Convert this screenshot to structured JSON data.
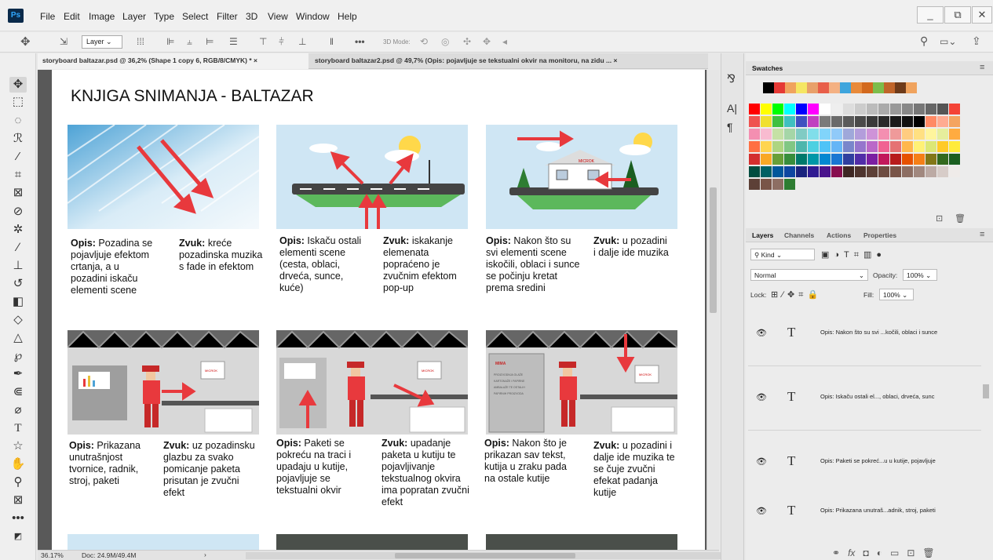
{
  "app": {
    "logo": "Ps",
    "menu": [
      "File",
      "Edit",
      "Image",
      "Layer",
      "Type",
      "Select",
      "Filter",
      "3D",
      "View",
      "Window",
      "Help"
    ]
  },
  "window_controls": {
    "minimize": "_",
    "restore": "⧉",
    "close": "✕"
  },
  "options_bar": {
    "layer_dropdown": "Layer",
    "mode_3d": "3D Mode:",
    "more": "•••"
  },
  "tabs": [
    {
      "label": "storyboard baltazar.psd @ 36,2% (Shape 1 copy 6, RGB/8/CMYK) *",
      "close": "×"
    },
    {
      "label": "storyboard baltazar2.psd @ 49,7% (Opis: pojavljuje se tekstualni okvir na monitoru, na zidu ...",
      "close": "×"
    }
  ],
  "document": {
    "title": "KNJIGA SNIMANJA - BALTAZAR",
    "panels": [
      {
        "opis_label": "Opis:",
        "opis": " Pozadina se pojavljuje efektom crtanja, a u pozadini iskaču elementi scene",
        "zvuk_label": "Zvuk:",
        "zvuk": " kreće pozadinska muzika s fade in efektom"
      },
      {
        "opis_label": "Opis:",
        "opis": " Iskaču ostali elementi scene (cesta, oblaci, drveća, sunce, kuće)",
        "zvuk_label": "Zvuk:",
        "zvuk": " iskakanje elemenata popraćeno je zvučnim efektom pop-up"
      },
      {
        "opis_label": "Opis:",
        "opis": " Nakon što su svi elementi scene iskočili, oblaci i sunce se počinju kretat prema sredini",
        "zvuk_label": "Zvuk:",
        "zvuk": " u pozadini i dalje ide muzika"
      },
      {
        "opis_label": "Opis:",
        "opis": " Prikazana unutrašnjost tvornice, radnik, stroj, paketi",
        "zvuk_label": "Zvuk:",
        "zvuk": " uz pozadinsku glazbu za svako pomicanje paketa prisutan je zvučni efekt"
      },
      {
        "opis_label": "Opis:",
        "opis": " Paketi se pokreću na traci i upadaju u kutije, pojavljuje se tekstualni okvir",
        "zvuk_label": "Zvuk:",
        "zvuk": " upadanje paketa u kutiju te pojavljivanje tekstualnog okvira ima popratan zvučni efekt"
      },
      {
        "opis_label": "Opis:",
        "opis": " Nakon što je prikazan sav tekst, kutija u zraku pada na ostale kutije",
        "zvuk_label": "Zvuk:",
        "zvuk": " u pozadini i dalje ide muzika te se čuje zvučni efekat padanja kutije"
      }
    ],
    "sign_text": "MICROK",
    "poster_title": "MIMA",
    "poster_lines": [
      "PROIZVODNJA OLAŽE",
      "KARTONAŽE I PAPIRNE",
      "AMBALAŽE TE OSTALIH",
      "PAPIRNIH PROIZVODA"
    ]
  },
  "status": {
    "zoom": "36.17%",
    "doc": "Doc: 24.9M/49.4M",
    "arrow": "›"
  },
  "swatches_panel": {
    "title": "Swatches"
  },
  "layers_panel": {
    "tabs": [
      "Layers",
      "Channels",
      "Actions",
      "Properties"
    ],
    "filter": "Kind",
    "blend_mode": "Normal",
    "opacity_label": "Opacity:",
    "opacity": "100%",
    "lock_label": "Lock:",
    "fill_label": "Fill:",
    "fill": "100%",
    "layers": [
      {
        "type": "T",
        "name": "Opis: Nakon što su svi ...kočili, oblaci i sunce"
      },
      {
        "type": "T",
        "name": "Opis: Iskaču ostali el..., oblaci, drveća, sunc"
      },
      {
        "type": "T",
        "name": "Opis: Paketi se pokreć...u u kutije, pojavljuje"
      },
      {
        "type": "T",
        "name": "Opis: Prikazana unutraš...adnik, stroj, paketi"
      }
    ]
  },
  "colors": {
    "accent": "#e8393d",
    "sky": "#cfe6f4"
  }
}
